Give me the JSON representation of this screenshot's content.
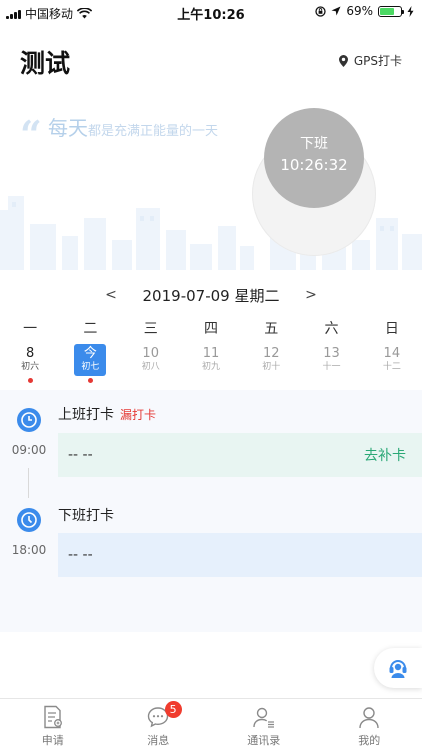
{
  "status_bar": {
    "carrier": "中国移动",
    "time": "上午10:26",
    "battery_text": "69%",
    "battery_level": 0.69
  },
  "header": {
    "title": "测试",
    "gps_label": "GPS打卡"
  },
  "hero": {
    "quote_big": "每天",
    "quote_rest": "都是充满正能量的一天",
    "clock_label": "下班",
    "clock_time": "10:26:32"
  },
  "date_nav": {
    "prev": "<",
    "date": "2019-07-09 星期二",
    "next": ">"
  },
  "weekdays": [
    "一",
    "二",
    "三",
    "四",
    "五",
    "六",
    "日"
  ],
  "days": [
    {
      "num": "8",
      "lunar": "初六",
      "state": "past",
      "dot": true
    },
    {
      "num": "今",
      "lunar": "初七",
      "state": "today",
      "dot": true
    },
    {
      "num": "10",
      "lunar": "初八",
      "state": "future",
      "dot": false
    },
    {
      "num": "11",
      "lunar": "初九",
      "state": "future",
      "dot": false
    },
    {
      "num": "12",
      "lunar": "初十",
      "state": "future",
      "dot": false
    },
    {
      "num": "13",
      "lunar": "十一",
      "state": "future",
      "dot": false
    },
    {
      "num": "14",
      "lunar": "十二",
      "state": "future",
      "dot": false
    }
  ],
  "records": [
    {
      "title": "上班打卡",
      "status": "漏打卡",
      "time": "09:00",
      "value": "-- --",
      "action": "去补卡"
    },
    {
      "title": "下班打卡",
      "status": "",
      "time": "18:00",
      "value": "-- --",
      "action": ""
    }
  ],
  "tabs": [
    {
      "label": "申请",
      "icon": "apply-icon",
      "badge": ""
    },
    {
      "label": "消息",
      "icon": "message-icon",
      "badge": "5"
    },
    {
      "label": "通讯录",
      "icon": "contacts-icon",
      "badge": ""
    },
    {
      "label": "我的",
      "icon": "profile-icon",
      "badge": ""
    }
  ],
  "colors": {
    "accent": "#3b8beb",
    "missed": "#e53935",
    "action": "#2aa876",
    "badge": "#f03c2e"
  }
}
